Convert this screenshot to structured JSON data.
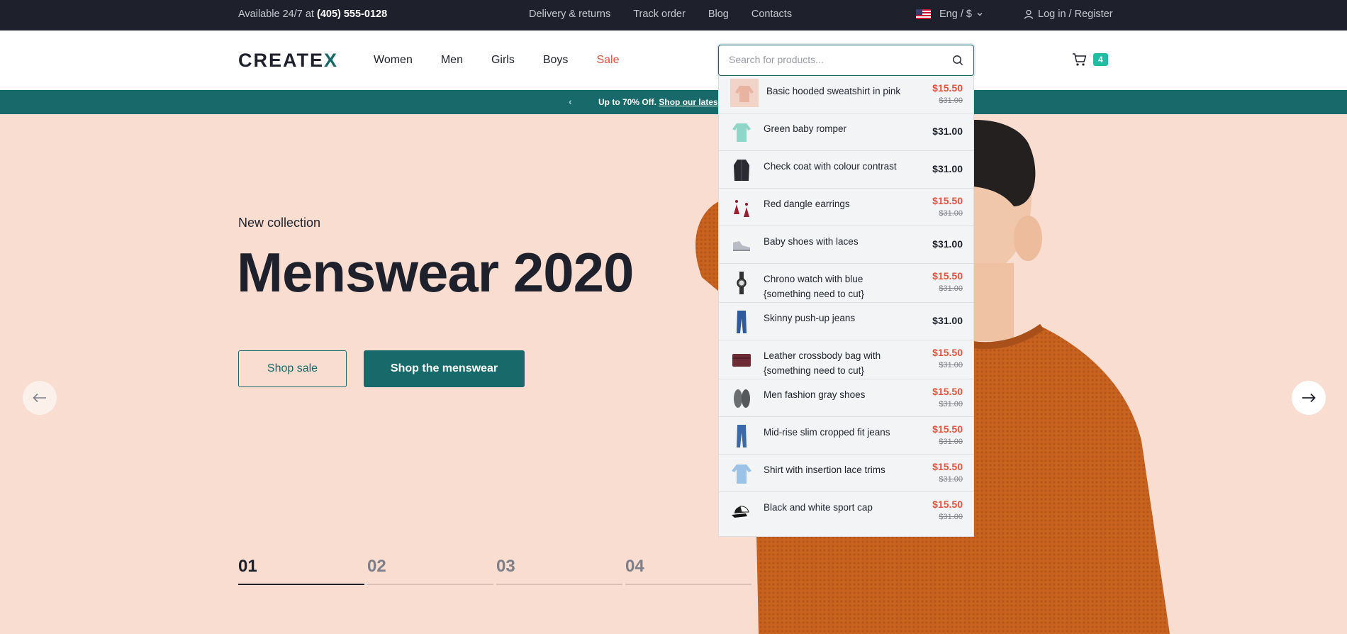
{
  "topbar": {
    "availability": "Available 24/7 at ",
    "phone": "(405) 555-0128",
    "links": [
      "Delivery & returns",
      "Track order",
      "Blog",
      "Contacts"
    ],
    "language": "Eng / $",
    "login": "Log in / Register"
  },
  "header": {
    "logo_main": "CREATE",
    "logo_accent": "X",
    "nav": [
      "Women",
      "Men",
      "Girls",
      "Boys",
      "Sale"
    ],
    "search_placeholder": "Search for products...",
    "search_value": "",
    "cart_count": "4"
  },
  "promo": {
    "prefix": "Up to 70% Off.",
    "link": "Shop our latest sale styles"
  },
  "hero": {
    "subtitle": "New collection",
    "title": "Menswear 2020",
    "btn_outline": "Shop sale",
    "btn_solid": "Shop the menswear",
    "pager": [
      "01",
      "02",
      "03",
      "04"
    ],
    "active_page": "01"
  },
  "search_results": [
    {
      "name": "Basic hooded sweatshirt in pink",
      "price": "$15.50",
      "old_price": "$31.00",
      "icon": "sweatshirt-icon"
    },
    {
      "name": "Green baby romper",
      "price": "$31.00",
      "old_price": "",
      "icon": "romper-icon"
    },
    {
      "name": "Check coat with colour contrast",
      "price": "$31.00",
      "old_price": "",
      "icon": "coat-icon"
    },
    {
      "name": "Red dangle earrings",
      "price": "$15.50",
      "old_price": "$31.00",
      "icon": "earrings-icon"
    },
    {
      "name": "Baby shoes with laces",
      "price": "$31.00",
      "old_price": "",
      "icon": "baby-shoes-icon"
    },
    {
      "name": "Chrono watch with blue {something need to cut}",
      "price": "$15.50",
      "old_price": "$31.00",
      "icon": "watch-icon"
    },
    {
      "name": "Skinny push-up jeans",
      "price": "$31.00",
      "old_price": "",
      "icon": "jeans-icon"
    },
    {
      "name": "Leather crossbody bag with {something need to cut}",
      "price": "$15.50",
      "old_price": "$31.00",
      "icon": "bag-icon"
    },
    {
      "name": "Men fashion gray shoes",
      "price": "$15.50",
      "old_price": "$31.00",
      "icon": "shoes-icon"
    },
    {
      "name": "Mid-rise slim cropped fit jeans",
      "price": "$15.50",
      "old_price": "$31.00",
      "icon": "jeans-icon"
    },
    {
      "name": "Shirt with insertion lace trims",
      "price": "$15.50",
      "old_price": "$31.00",
      "icon": "shirt-icon"
    },
    {
      "name": "Black and white sport cap",
      "price": "$15.50",
      "old_price": "$31.00",
      "icon": "cap-icon"
    }
  ],
  "colors": {
    "dark": "#1e212c",
    "primary": "#17696a",
    "accent": "#1fbda3",
    "sale": "#e5533d",
    "hero_bg": "#f8ddd0",
    "sweater": "#c8621f"
  }
}
